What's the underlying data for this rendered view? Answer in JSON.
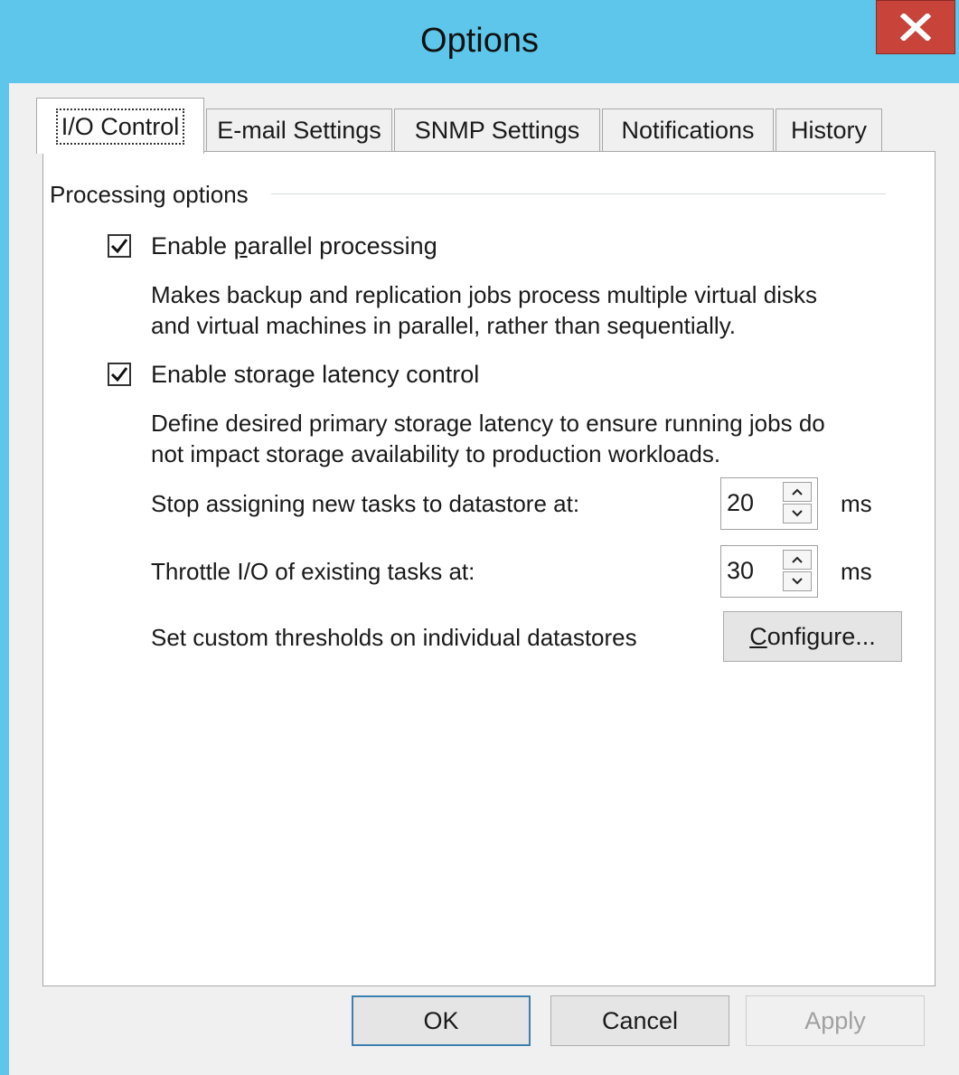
{
  "window": {
    "title": "Options",
    "close_label": "X"
  },
  "tabs": [
    {
      "label": "I/O Control",
      "active": true
    },
    {
      "label": "E-mail Settings",
      "active": false
    },
    {
      "label": "SNMP Settings",
      "active": false
    },
    {
      "label": "Notifications",
      "active": false
    },
    {
      "label": "History",
      "active": false
    }
  ],
  "processing": {
    "group_label": "Processing options",
    "parallel": {
      "checked": true,
      "label_pre": "Enable ",
      "label_mnemonic": "p",
      "label_post": "arallel processing",
      "desc_line1": "Makes backup and replication jobs process multiple virtual disks",
      "desc_line2": "and virtual machines in parallel, rather than sequentially."
    },
    "latency": {
      "checked": true,
      "label": "Enable storage latency control",
      "desc_line1": "Define desired primary storage latency to ensure running jobs do",
      "desc_line2": "not impact storage availability to production workloads.",
      "stop_label": "Stop assigning new tasks to datastore at:",
      "stop_value": "20",
      "throttle_label": "Throttle I/O of existing tasks at:",
      "throttle_value": "30",
      "unit": "ms",
      "custom_label": "Set custom thresholds on individual datastores",
      "configure_mnemonic": "C",
      "configure_rest": "onfigure..."
    }
  },
  "buttons": {
    "ok": "OK",
    "cancel": "Cancel",
    "apply": "Apply"
  }
}
